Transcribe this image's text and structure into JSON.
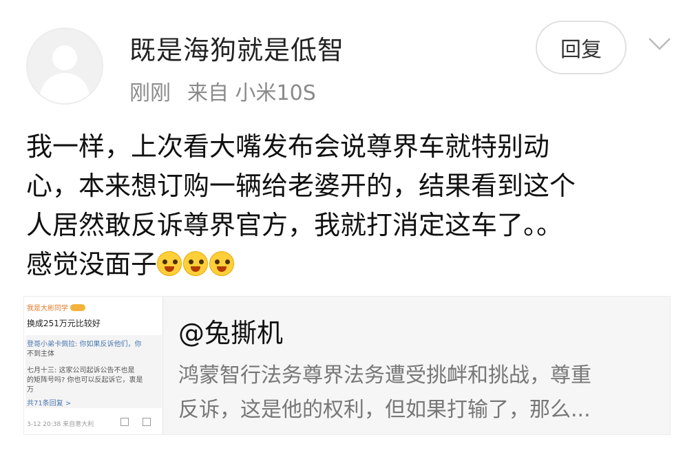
{
  "post": {
    "username": "既是海狗就是低智",
    "time": "刚刚",
    "source": "来自 小米10S",
    "reply_label": "回复",
    "content_lines": [
      "我一样，上次看大嘴发布会说尊界车就特别动",
      "心，本来想订购一辆给老婆开的，结果看到这个",
      "人居然敢反诉尊界官方，我就打消定这车了。。",
      "感觉没面子"
    ],
    "emojis": [
      "crying-face",
      "crying-face",
      "crying-face"
    ]
  },
  "card": {
    "title": "@兔撕机",
    "desc_lines": [
      "鸿蒙智行法务尊界法务遭受挑衅和挑战，尊重",
      "反诉，这是他的权利，但如果打输了，那么..."
    ],
    "thumb": {
      "user": "我是大彬同学",
      "line1": "换成251万元比较好",
      "reply1": "登哥小弟卡佩拉: 你如果反诉他们，你",
      "reply1b": "不到主体",
      "reply2": "七月十三: 这家公司起诉公告不也是",
      "reply2b": "的矩阵号吗? 你也可以反起诉它，衷是",
      "reply2c": "万",
      "more": "共71条回复 >",
      "footer": "3-12 20:38 来自意大利"
    }
  }
}
